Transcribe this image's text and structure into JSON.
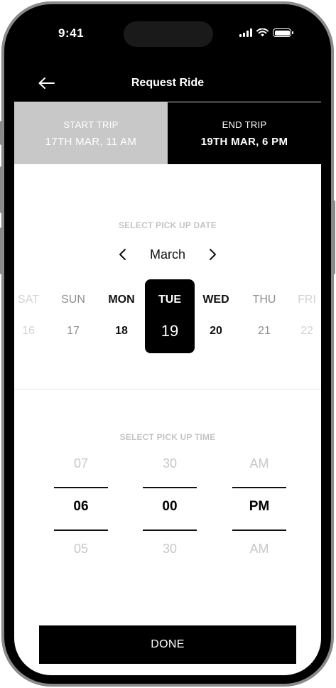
{
  "status_bar": {
    "time": "9:41"
  },
  "header": {
    "title": "Request Ride",
    "back_icon": "arrow-left-icon"
  },
  "trip_tabs": {
    "start": {
      "label": "START TRIP",
      "value": "17TH MAR, 11 AM"
    },
    "end": {
      "label": "END TRIP",
      "value": "19TH MAR, 6 PM"
    },
    "selected": "end"
  },
  "date_picker": {
    "label": "SELECT PICK UP DATE",
    "month": "March",
    "days": [
      {
        "name": "SAT",
        "num": "16"
      },
      {
        "name": "SUN",
        "num": "17"
      },
      {
        "name": "MON",
        "num": "18"
      },
      {
        "name": "TUE",
        "num": "19"
      },
      {
        "name": "WED",
        "num": "20"
      },
      {
        "name": "THU",
        "num": "21"
      },
      {
        "name": "FRI",
        "num": "22"
      }
    ],
    "selected_day": "19"
  },
  "time_picker": {
    "label": "SELECT PICK UP TIME",
    "hour": {
      "prev": "07",
      "current": "06",
      "next": "05"
    },
    "minute": {
      "prev": "30",
      "current": "00",
      "next": "30"
    },
    "period": {
      "prev": "AM",
      "current": "PM",
      "next": "AM"
    }
  },
  "done_button": {
    "label": "DONE"
  },
  "colors": {
    "primary": "#000000",
    "inactive_tab": "#c8c8c8",
    "muted_text": "#c4c4c4"
  }
}
